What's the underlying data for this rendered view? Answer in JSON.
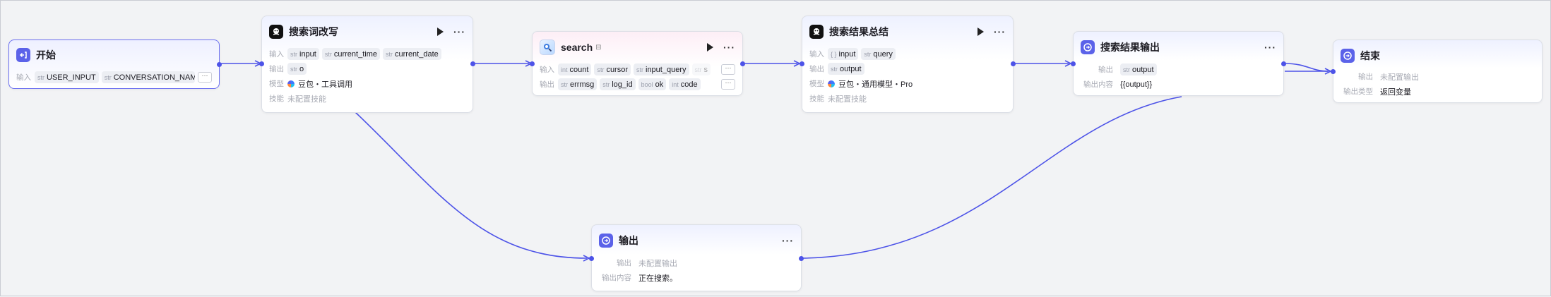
{
  "colors": {
    "accent": "#4d53e8",
    "edge": "#4d53e8",
    "canvas": "#f2f3f5"
  },
  "nodes": {
    "start": {
      "title": "开始",
      "icon": "start-icon",
      "input_label": "输入",
      "inputs": [
        {
          "type": "str",
          "name": "USER_INPUT"
        },
        {
          "type": "str",
          "name": "CONVERSATION_NAME"
        }
      ]
    },
    "rewrite": {
      "title": "搜索词改写",
      "icon": "llm-icon",
      "input_label": "输入",
      "inputs": [
        {
          "type": "str",
          "name": "input"
        },
        {
          "type": "str",
          "name": "current_time"
        },
        {
          "type": "str",
          "name": "current_date"
        }
      ],
      "output_label": "输出",
      "outputs": [
        {
          "type": "str",
          "name": "o"
        }
      ],
      "model_label": "模型",
      "model": "豆包・工具调用",
      "skill_label": "技能",
      "skill": "未配置技能"
    },
    "search": {
      "title": "search",
      "icon": "plugin-icon",
      "input_label": "输入",
      "inputs": [
        {
          "type": "int",
          "name": "count"
        },
        {
          "type": "str",
          "name": "cursor"
        },
        {
          "type": "str",
          "name": "input_query"
        },
        {
          "type": "str",
          "name": "s"
        }
      ],
      "output_label": "输出",
      "outputs": [
        {
          "type": "str",
          "name": "errmsg"
        },
        {
          "type": "str",
          "name": "log_id"
        },
        {
          "type": "bool",
          "name": "ok"
        },
        {
          "type": "int",
          "name": "code"
        }
      ]
    },
    "summary": {
      "title": "搜索结果总结",
      "icon": "llm-icon",
      "input_label": "输入",
      "inputs": [
        {
          "type": "{ }",
          "name": "input"
        },
        {
          "type": "str",
          "name": "query"
        }
      ],
      "output_label": "输出",
      "outputs": [
        {
          "type": "str",
          "name": "output"
        }
      ],
      "model_label": "模型",
      "model": "豆包・通用模型・Pro",
      "skill_label": "技能",
      "skill": "未配置技能"
    },
    "result_out": {
      "title": "搜索结果输出",
      "icon": "message-icon",
      "output_label": "输出",
      "outputs": [
        {
          "type": "str",
          "name": "output"
        }
      ],
      "content_label": "输出内容",
      "content": "{{output}}"
    },
    "end": {
      "title": "结束",
      "icon": "end-icon",
      "output_label": "输出",
      "output": "未配置输出",
      "type_label": "输出类型",
      "type_value": "返回变量"
    },
    "output": {
      "title": "输出",
      "icon": "message-icon",
      "output_label": "输出",
      "output": "未配置输出",
      "content_label": "输出内容",
      "content": "正在搜索。"
    }
  }
}
